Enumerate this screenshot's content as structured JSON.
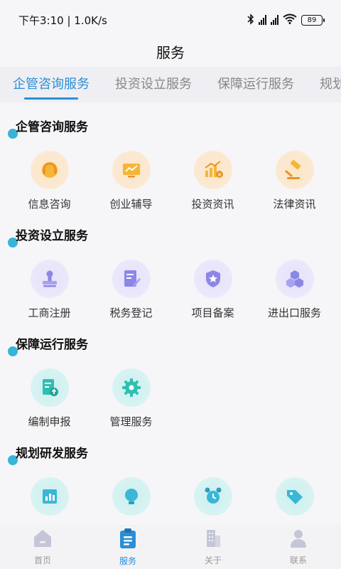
{
  "status_bar": {
    "time": "下午3:10 | 1.0K/s",
    "battery": "89"
  },
  "header": {
    "title": "服务"
  },
  "tabs": [
    {
      "label": "企管咨询服务",
      "active": true
    },
    {
      "label": "投资设立服务",
      "active": false
    },
    {
      "label": "保障运行服务",
      "active": false
    },
    {
      "label": "规划研发服务",
      "active": false
    }
  ],
  "sections": [
    {
      "title": "企管咨询服务",
      "items": [
        {
          "label": "信息咨询",
          "icon": "headset-icon"
        },
        {
          "label": "创业辅导",
          "icon": "monitor-chart-icon"
        },
        {
          "label": "投资资讯",
          "icon": "bar-growth-icon"
        },
        {
          "label": "法律资讯",
          "icon": "gavel-icon"
        }
      ]
    },
    {
      "title": "投资设立服务",
      "items": [
        {
          "label": "工商注册",
          "icon": "stamp-icon"
        },
        {
          "label": "税务登记",
          "icon": "edit-document-icon"
        },
        {
          "label": "项目备案",
          "icon": "star-shield-icon"
        },
        {
          "label": "进出口服务",
          "icon": "cubes-icon"
        }
      ]
    },
    {
      "title": "保障运行服务",
      "items": [
        {
          "label": "编制申报",
          "icon": "upload-document-icon"
        },
        {
          "label": "管理服务",
          "icon": "gear-icon"
        }
      ]
    },
    {
      "title": "规划研发服务",
      "items": [
        {
          "label": "",
          "icon": "chart-icon"
        },
        {
          "label": "",
          "icon": "bulb-icon"
        },
        {
          "label": "",
          "icon": "alarm-icon"
        },
        {
          "label": "",
          "icon": "tag-icon"
        }
      ]
    }
  ],
  "bottom_nav": [
    {
      "label": "首页",
      "icon": "home-icon",
      "active": false
    },
    {
      "label": "服务",
      "icon": "clipboard-icon",
      "active": true
    },
    {
      "label": "关于",
      "icon": "building-icon",
      "active": false
    },
    {
      "label": "联系",
      "icon": "contact-icon",
      "active": false
    }
  ],
  "colors": {
    "accent": "#2b8fd6",
    "section_dot": "#36b5d9",
    "orange_icon": "#f5b536",
    "purple_icon": "#8c86e6",
    "teal_icon": "#2fbfb0"
  }
}
